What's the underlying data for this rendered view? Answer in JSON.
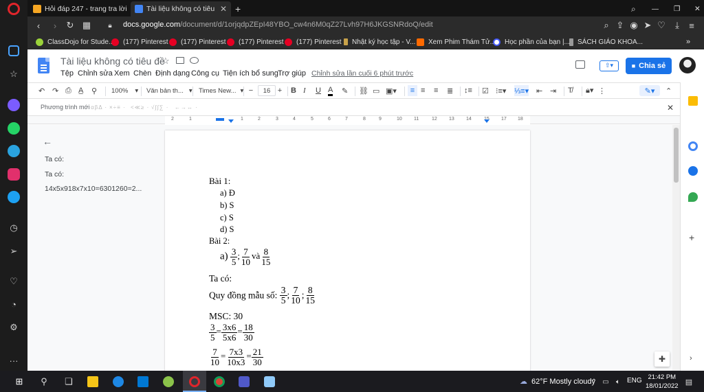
{
  "browser": {
    "tabs": [
      {
        "title": "Hỏi đáp 247 - trang tra lời",
        "icon": "hoidap-icon"
      },
      {
        "title": "Tài liệu không có tiêu đề - Google",
        "icon": "docs-icon"
      }
    ],
    "url_host": "docs.google.com",
    "url_path": "/document/d/1orjqdpZEpI48YBO_cw4n6M0qZ27Lvh97H6JKGSNRdoQ/edit",
    "bookmarks": [
      "ClassDojo for Stude...",
      "(177) Pinterest",
      "(177) Pinterest",
      "(177) Pinterest",
      "(177) Pinterest",
      "Nhật ký học tập - V...",
      "Xem Phim Thám Tử...",
      "Học phần của bạn |...",
      "SÁCH GIÁO KHOA..."
    ]
  },
  "docs": {
    "title": "Tài liệu không có tiêu đề",
    "menu": [
      "Tệp",
      "Chỉnh sửa",
      "Xem",
      "Chèn",
      "Định dạng",
      "Công cụ",
      "Tiện ích bổ sung",
      "Trợ giúp"
    ],
    "last_edit": "Chỉnh sửa lần cuối 6 phút trước",
    "share_label": "Chia sẻ",
    "toolbar": {
      "zoom": "100%",
      "style": "Văn bản th...",
      "font": "Times New...",
      "font_size": "16"
    },
    "equation": {
      "label": "Phương trình mới",
      "groups": [
        "αβΔ ·",
        "×÷≡ ·",
        "<≪≥ ·",
        "√∫∫∑ ·",
        "←→↔ ·"
      ]
    },
    "ruler_numbers": [
      "2",
      "1",
      "1",
      "2",
      "3",
      "4",
      "5",
      "6",
      "7",
      "8",
      "9",
      "10",
      "11",
      "12",
      "13",
      "14",
      "15",
      "16",
      "17",
      "18"
    ],
    "outline": [
      "Ta có:",
      "Ta có:",
      "14x5x918x7x10=6301260=2..."
    ],
    "content": {
      "bai1_title": "Bài 1:",
      "bai1_items": [
        "a)  Đ",
        "b)  S",
        "c)  S",
        "d)  S"
      ],
      "bai2_title": "Bài 2:",
      "a_label": "a)",
      "a_fracs": [
        [
          "3",
          "5"
        ],
        [
          "7",
          "10"
        ],
        [
          "8",
          "15"
        ]
      ],
      "a_sep": ";",
      "a_and": "và",
      "ta_co": "Ta có:",
      "quy_dong": "Quy đồng mẫu số:",
      "qd_fracs": [
        [
          "3",
          "5"
        ],
        [
          "7",
          "10"
        ],
        [
          "8",
          "15"
        ]
      ],
      "msc": "MSC: 30",
      "line1": [
        [
          "3",
          "5"
        ],
        [
          "3x6",
          "5x6"
        ],
        [
          "18",
          "30"
        ]
      ],
      "line2": [
        [
          "7",
          "10"
        ],
        [
          "7x3",
          "10x3"
        ],
        [
          "21",
          "30"
        ]
      ],
      "eq": "="
    }
  },
  "taskbar": {
    "weather": "62°F  Mostly cloudy",
    "lang": "ENG",
    "time": "21:42 PM",
    "date": "18/01/2022"
  }
}
